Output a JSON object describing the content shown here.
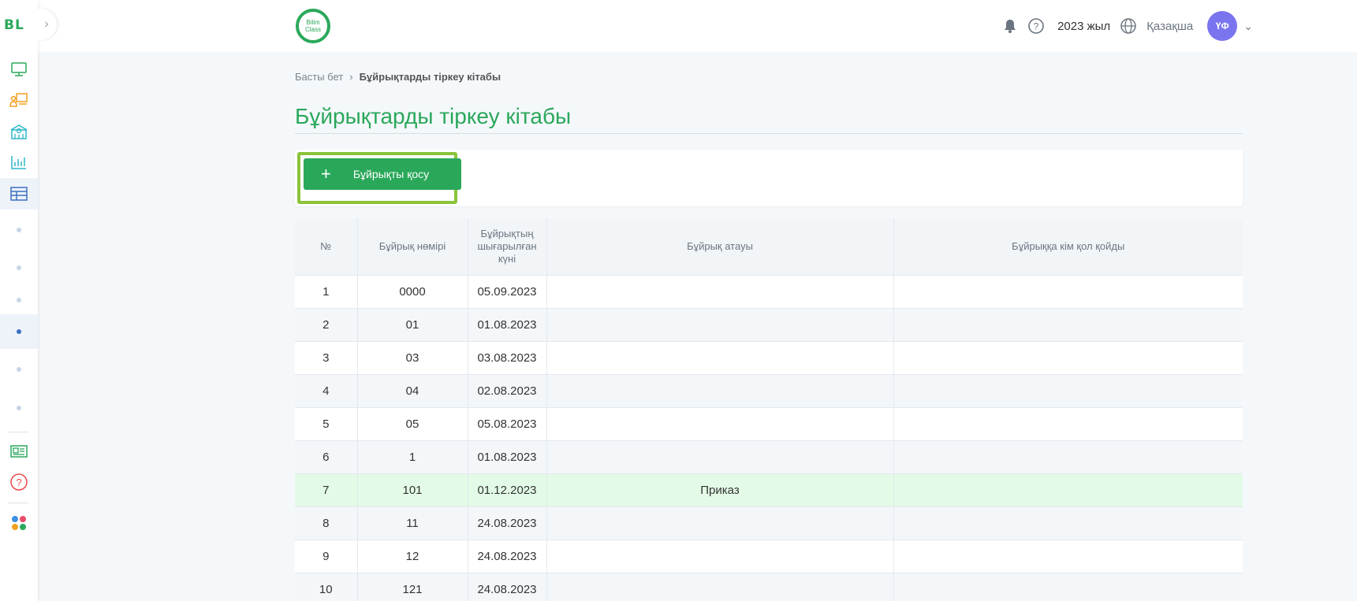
{
  "sidebar": {
    "logo": "BL",
    "toggle_icon": "chevron-right-icon",
    "items": [
      {
        "icon": "monitor-icon",
        "color": "#2aa85a"
      },
      {
        "icon": "teacher-board-icon",
        "color": "#f0a020"
      },
      {
        "icon": "school-building-icon",
        "color": "#2bb5c8"
      },
      {
        "icon": "bar-chart-icon",
        "color": "#2bb5c8"
      },
      {
        "icon": "table-icon",
        "color": "#3d6fbf"
      }
    ],
    "active_item": "table-icon",
    "bottom_icons": [
      "news-icon",
      "help-icon",
      "apps-grid-icon"
    ]
  },
  "header": {
    "brand_text_1": "Bilim",
    "brand_text_2": "Class",
    "year": "2023 жыл",
    "language": "Қазақша",
    "avatar_initials": "ҮФ"
  },
  "breadcrumb": {
    "home": "Басты бет",
    "current": "Бұйрықтарды тіркеу кітабы"
  },
  "page_title": "Бұйрықтарды тіркеу кітабы",
  "toolbar": {
    "add_label": "Бұйрықты қосу"
  },
  "table": {
    "headers": {
      "num": "№",
      "order_number": "Бұйрық нөмірі",
      "date_1": "Бұйрықтың",
      "date_2": "шығарылған",
      "date_3": "күні",
      "title": "Бұйрық атауы",
      "signed_by": "Бұйрыққа кім қол қойды"
    },
    "rows": [
      {
        "n": "1",
        "number": "0000",
        "date": "05.09.2023",
        "title": "",
        "signed": ""
      },
      {
        "n": "2",
        "number": "01",
        "date": "01.08.2023",
        "title": "",
        "signed": ""
      },
      {
        "n": "3",
        "number": "03",
        "date": "03.08.2023",
        "title": "",
        "signed": ""
      },
      {
        "n": "4",
        "number": "04",
        "date": "02.08.2023",
        "title": "",
        "signed": ""
      },
      {
        "n": "5",
        "number": "05",
        "date": "05.08.2023",
        "title": "",
        "signed": ""
      },
      {
        "n": "6",
        "number": "1",
        "date": "01.08.2023",
        "title": "",
        "signed": ""
      },
      {
        "n": "7",
        "number": "101",
        "date": "01.12.2023",
        "title": "Приказ",
        "signed": ""
      },
      {
        "n": "8",
        "number": "11",
        "date": "24.08.2023",
        "title": "",
        "signed": ""
      },
      {
        "n": "9",
        "number": "12",
        "date": "24.08.2023",
        "title": "",
        "signed": ""
      },
      {
        "n": "10",
        "number": "121",
        "date": "24.08.2023",
        "title": "",
        "signed": ""
      }
    ]
  },
  "colors": {
    "accent": "#2aa85a",
    "highlight_border": "#8bc33a",
    "highlight_row": "#e3fbe6",
    "avatar": "#7a74ef"
  }
}
